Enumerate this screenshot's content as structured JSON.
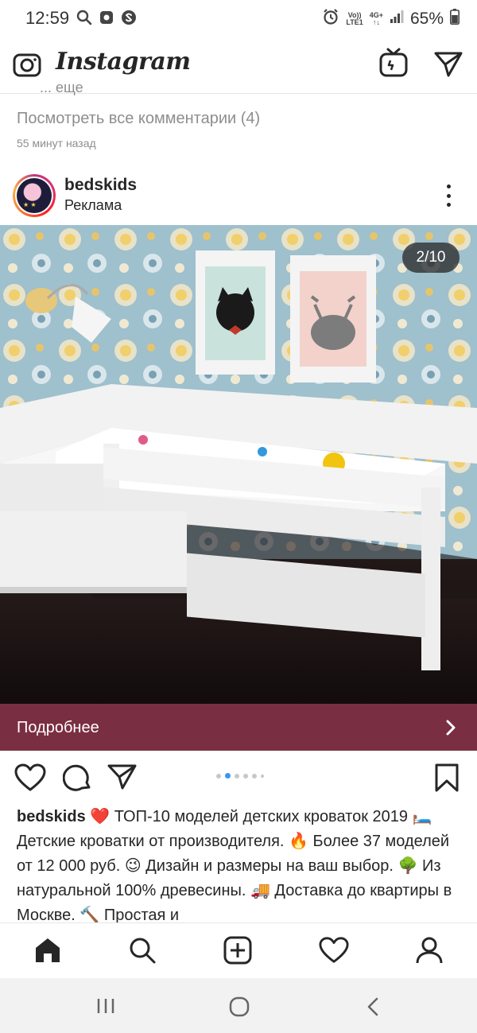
{
  "status_bar": {
    "time": "12:59",
    "volte_top": "Vo))",
    "volte_bottom": "LTE1",
    "network_top": "4G+",
    "network_bottom": "↑↓",
    "battery": "65%",
    "left_icons": [
      "search-icon",
      "screenshot-icon",
      "shazam-icon"
    ],
    "right_icons": [
      "alarm-icon",
      "signal-icon",
      "battery-icon"
    ]
  },
  "header": {
    "logo": "Instagram",
    "icons": [
      "camera-icon",
      "igtv-icon",
      "direct-message-icon"
    ]
  },
  "previous_post": {
    "more": "... еще",
    "view_comments": "Посмотреть все комментарии (4)",
    "time_ago": "55 минут назад"
  },
  "post": {
    "username": "bedskids",
    "sponsored": "Реклама",
    "image_counter": "2/10",
    "cta": "Подробнее",
    "cta_color": "#7a2e42",
    "carousel": {
      "total_dots": 6,
      "active_index": 1
    },
    "caption": {
      "username": "bedskids",
      "text": "❤️ ТОП-10 моделей детских кроваток 2019 🛏️ Детские кроватки от производителя. 🔥 Более 37 моделей от 12 000 руб. 😉 Дизайн и размеры на ваш выбор. 🌳 Из натуральной 100% древесины. 🚚 Доставка до квартиры в Москве. 🔨 Простая и"
    },
    "action_icons": [
      "heart-icon",
      "comment-icon",
      "share-icon",
      "bookmark-icon"
    ]
  },
  "bottom_nav": [
    "home-icon",
    "search-icon",
    "new-post-icon",
    "activity-heart-icon",
    "profile-icon"
  ],
  "system_nav": [
    "recent-apps-icon",
    "home-circle-icon",
    "back-icon"
  ]
}
